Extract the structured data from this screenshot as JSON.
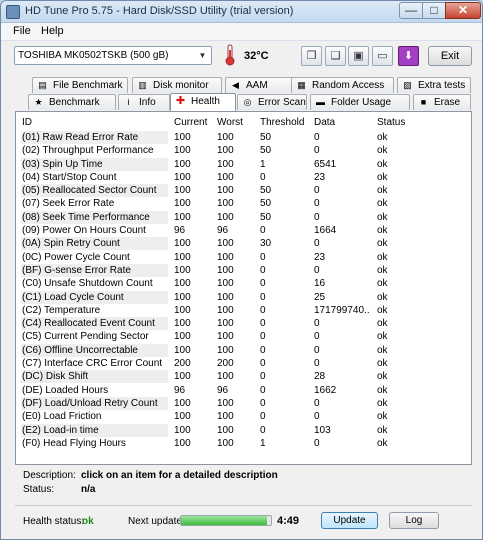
{
  "window": {
    "title": "HD Tune Pro 5.75 - Hard Disk/SSD Utility (trial version)",
    "minimize": "—",
    "maximize": "□",
    "close": "✕"
  },
  "menu": {
    "file": "File",
    "help": "Help"
  },
  "toolbar": {
    "drive": "TOSHIBA MK0502TSKB (500 gB)",
    "drive_arrow": "▼",
    "temperature": "32°C",
    "exit": "Exit",
    "icons": [
      "copy-info-icon",
      "copy-text-icon",
      "screenshot-icon",
      "save-icon",
      "download-icon"
    ],
    "icon_glyphs": [
      "❐",
      "❑",
      "▣",
      "▭",
      "⬇"
    ]
  },
  "tabs": {
    "row1": [
      {
        "label": "File Benchmark",
        "icon": "file-benchmark-icon",
        "glyph": "▤"
      },
      {
        "label": "Disk monitor",
        "icon": "disk-monitor-icon",
        "glyph": "▥"
      },
      {
        "label": "AAM",
        "icon": "speaker-icon",
        "glyph": "◀"
      },
      {
        "label": "Random Access",
        "icon": "random-access-icon",
        "glyph": "▦"
      },
      {
        "label": "Extra tests",
        "icon": "extra-tests-icon",
        "glyph": "▧"
      }
    ],
    "row2": [
      {
        "label": "Benchmark",
        "icon": "benchmark-icon",
        "glyph": "★"
      },
      {
        "label": "Info",
        "icon": "info-icon",
        "glyph": "i"
      },
      {
        "label": "Health",
        "icon": "health-cross-icon",
        "glyph": "✚"
      },
      {
        "label": "Error Scan",
        "icon": "magnifier-icon",
        "glyph": "◎"
      },
      {
        "label": "Folder Usage",
        "icon": "folder-icon",
        "glyph": "▬"
      },
      {
        "label": "Erase",
        "icon": "erase-icon",
        "glyph": "■"
      }
    ]
  },
  "table": {
    "headers": [
      "ID",
      "Current",
      "Worst",
      "Threshold",
      "Data",
      "Status"
    ],
    "rows": [
      [
        "(01) Raw Read Error Rate",
        "100",
        "100",
        "50",
        "0",
        "ok"
      ],
      [
        "(02) Throughput Performance",
        "100",
        "100",
        "50",
        "0",
        "ok"
      ],
      [
        "(03) Spin Up Time",
        "100",
        "100",
        "1",
        "6541",
        "ok"
      ],
      [
        "(04) Start/Stop Count",
        "100",
        "100",
        "0",
        "23",
        "ok"
      ],
      [
        "(05) Reallocated Sector Count",
        "100",
        "100",
        "50",
        "0",
        "ok"
      ],
      [
        "(07) Seek Error Rate",
        "100",
        "100",
        "50",
        "0",
        "ok"
      ],
      [
        "(08) Seek Time Performance",
        "100",
        "100",
        "50",
        "0",
        "ok"
      ],
      [
        "(09) Power On Hours Count",
        "96",
        "96",
        "0",
        "1664",
        "ok"
      ],
      [
        "(0A) Spin Retry Count",
        "100",
        "100",
        "30",
        "0",
        "ok"
      ],
      [
        "(0C) Power Cycle Count",
        "100",
        "100",
        "0",
        "23",
        "ok"
      ],
      [
        "(BF) G-sense Error Rate",
        "100",
        "100",
        "0",
        "0",
        "ok"
      ],
      [
        "(C0) Unsafe Shutdown Count",
        "100",
        "100",
        "0",
        "16",
        "ok"
      ],
      [
        "(C1) Load Cycle Count",
        "100",
        "100",
        "0",
        "25",
        "ok"
      ],
      [
        "(C2) Temperature",
        "100",
        "100",
        "0",
        "171799740...",
        "ok"
      ],
      [
        "(C4) Reallocated Event Count",
        "100",
        "100",
        "0",
        "0",
        "ok"
      ],
      [
        "(C5) Current Pending Sector",
        "100",
        "100",
        "0",
        "0",
        "ok"
      ],
      [
        "(C6) Offline Uncorrectable",
        "100",
        "100",
        "0",
        "0",
        "ok"
      ],
      [
        "(C7) Interface CRC Error Count",
        "200",
        "200",
        "0",
        "0",
        "ok"
      ],
      [
        "(DC) Disk Shift",
        "100",
        "100",
        "0",
        "28",
        "ok"
      ],
      [
        "(DE) Loaded Hours",
        "96",
        "96",
        "0",
        "1662",
        "ok"
      ],
      [
        "(DF) Load/Unload Retry Count",
        "100",
        "100",
        "0",
        "0",
        "ok"
      ],
      [
        "(E0) Load Friction",
        "100",
        "100",
        "0",
        "0",
        "ok"
      ],
      [
        "(E2) Load-in time",
        "100",
        "100",
        "0",
        "103",
        "ok"
      ],
      [
        "(F0) Head Flying Hours",
        "100",
        "100",
        "1",
        "0",
        "ok"
      ]
    ]
  },
  "description": {
    "label": "Description:",
    "value": "click on an item for a detailed description",
    "status_label": "Status:",
    "status_value": "n/a"
  },
  "footer": {
    "health_label": "Health status:",
    "health_value": "ok",
    "next_label": "Next update:",
    "progress": 0.95,
    "timer": "4:49",
    "update": "Update",
    "log": "Log"
  },
  "colors": {
    "health_ok": "#1a8a1a",
    "close_button": "#c7432f",
    "download_button": "#a23fc4"
  }
}
